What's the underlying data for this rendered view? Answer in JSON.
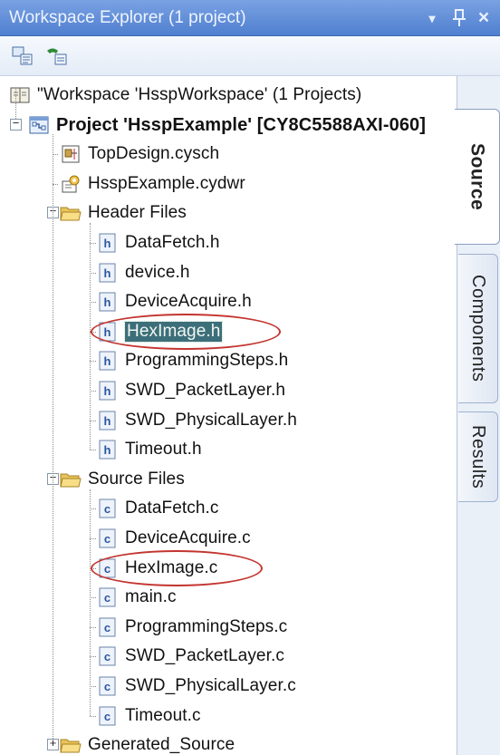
{
  "window": {
    "title": "Workspace Explorer (1 project)",
    "controls": {
      "dropdown": "▾",
      "pin": "ꟸ",
      "close": "×"
    }
  },
  "toolbar": {
    "buttons": [
      "properties-icon",
      "hierarchy-icon"
    ]
  },
  "side_tabs": [
    {
      "label": "Source",
      "active": true
    },
    {
      "label": "Components",
      "active": false
    },
    {
      "label": "Results",
      "active": false
    }
  ],
  "tree": {
    "workspace": "\"Workspace 'HsspWorkspace' (1 Projects)",
    "project": "Project 'HsspExample' [CY8C5588AXI-060]",
    "project_items": [
      "TopDesign.cysch",
      "HsspExample.cydwr"
    ],
    "header_folder": "Header Files",
    "header_files": [
      "DataFetch.h",
      "device.h",
      "DeviceAcquire.h",
      "HexImage.h",
      "ProgrammingSteps.h",
      "SWD_PacketLayer.h",
      "SWD_PhysicalLayer.h",
      "Timeout.h"
    ],
    "source_folder": "Source Files",
    "source_files": [
      "DataFetch.c",
      "DeviceAcquire.c",
      "HexImage.c",
      "main.c",
      "ProgrammingSteps.c",
      "SWD_PacketLayer.c",
      "SWD_PhysicalLayer.c",
      "Timeout.c"
    ],
    "generated_folder": "Generated_Source",
    "expanders": {
      "expanded": "−",
      "collapsed": "+"
    }
  },
  "colors": {
    "title_bar": "#5f8ed9",
    "selection": "#3d6f7a",
    "highlight_circle": "#c3342f"
  }
}
